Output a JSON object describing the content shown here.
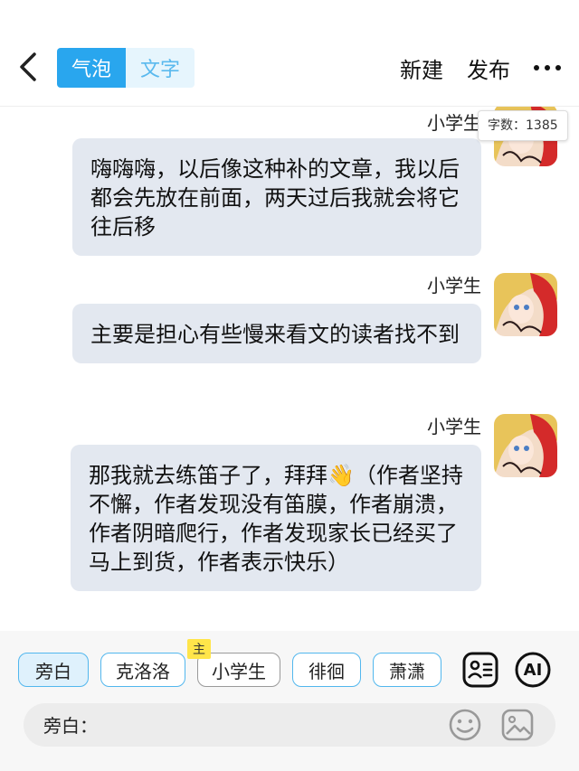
{
  "header": {
    "tabs": [
      {
        "label": "气泡",
        "active": true
      },
      {
        "label": "文字",
        "active": false
      }
    ],
    "new_label": "新建",
    "publish_label": "发布"
  },
  "word_count": "字数：1385",
  "messages": [
    {
      "name": "小学生",
      "text": "嗨嗨嗨，以后像这种补的文章，我以后都会先放在前面，两天过后我就会将它往后移",
      "avatar": "anime-girl-avatar"
    },
    {
      "name": "小学生",
      "text": "主要是担心有些慢来看文的读者找不到",
      "avatar": "anime-girl-avatar"
    },
    {
      "name": "小学生",
      "text": "那我就去练笛子了，拜拜👋（作者坚持不懈，作者发现没有笛膜，作者崩溃，作者阴暗爬行，作者发现家长已经买了马上到货，作者表示快乐）",
      "avatar": "anime-girl-avatar"
    }
  ],
  "roles": [
    {
      "label": "旁白",
      "selected": true
    },
    {
      "label": "克洛洛",
      "selected": false
    },
    {
      "label": "小学生",
      "selected": false,
      "tag": "主"
    },
    {
      "label": "徘徊",
      "selected": false
    },
    {
      "label": "萧潇",
      "selected": false
    }
  ],
  "ai_label": "AI",
  "composer": {
    "speaker_label": "旁白：",
    "value": ""
  },
  "colors": {
    "accent": "#29a6ee",
    "bubble": "#e3e8f0",
    "tag": "#ffe54a"
  }
}
